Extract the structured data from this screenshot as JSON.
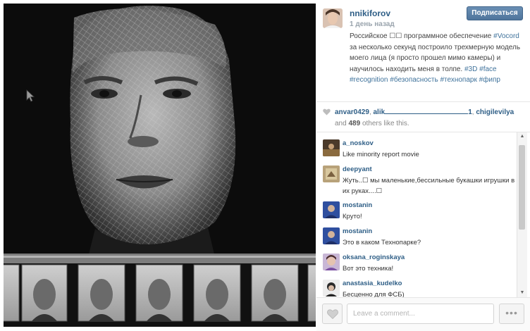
{
  "post": {
    "username": "nnikiforov",
    "timestamp": "1 день назад",
    "follow_label": "Подписаться",
    "caption_segments": [
      {
        "text": "Российское ☐☐ программное обеспечение ",
        "hashtag": false
      },
      {
        "text": "#Vocord",
        "hashtag": true
      },
      {
        "text": " за несколько секунд построило трехмерную модель моего лица (я просто прошел мимо камеры) и научилось находить меня в толпе. ",
        "hashtag": false
      },
      {
        "text": "#3D",
        "hashtag": true
      },
      {
        "text": " ",
        "hashtag": false
      },
      {
        "text": "#face",
        "hashtag": true
      },
      {
        "text": " ",
        "hashtag": false
      },
      {
        "text": "#recognition",
        "hashtag": true
      },
      {
        "text": " ",
        "hashtag": false
      },
      {
        "text": "#безопасность",
        "hashtag": true
      },
      {
        "text": " ",
        "hashtag": false
      },
      {
        "text": "#технопарк",
        "hashtag": true
      },
      {
        "text": " ",
        "hashtag": false
      },
      {
        "text": "#фипр",
        "hashtag": true
      }
    ]
  },
  "likes": {
    "likers": [
      "anvar0429",
      "alik",
      "1",
      "chigilevilya"
    ],
    "sep": ", ",
    "and_text": "and",
    "others_count": "489",
    "others_text": "others like this."
  },
  "comments": [
    {
      "username": "a_noskov",
      "text": "Like minority report movie"
    },
    {
      "username": "deepyant",
      "text": "Жуть..☐ мы маленькие,бессильные букашки игрушки в их руках....☐"
    },
    {
      "username": "mostanin",
      "text": "Круто!"
    },
    {
      "username": "mostanin",
      "text": "Это в каком Технопарке?"
    },
    {
      "username": "oksana_roginskaya",
      "text": "Вот это техника!"
    },
    {
      "username": "anastasia_kudelko",
      "text": "Бесценно для ФСБ)"
    }
  ],
  "footer": {
    "comment_placeholder": "Leave a comment...",
    "more_label": "•••"
  },
  "icons": {
    "like_button": "heart-icon",
    "likes_indicator": "heart-icon",
    "cursor": "mouse-pointer-icon",
    "scroll_up": "up-arrow-icon",
    "scroll_down": "down-arrow-icon"
  },
  "scroll_arrows": {
    "up": "▲",
    "down": "▼"
  },
  "colors": {
    "link": "#2e5e86",
    "hashtag": "#3f729b",
    "follow_button": "#5b80a8"
  }
}
